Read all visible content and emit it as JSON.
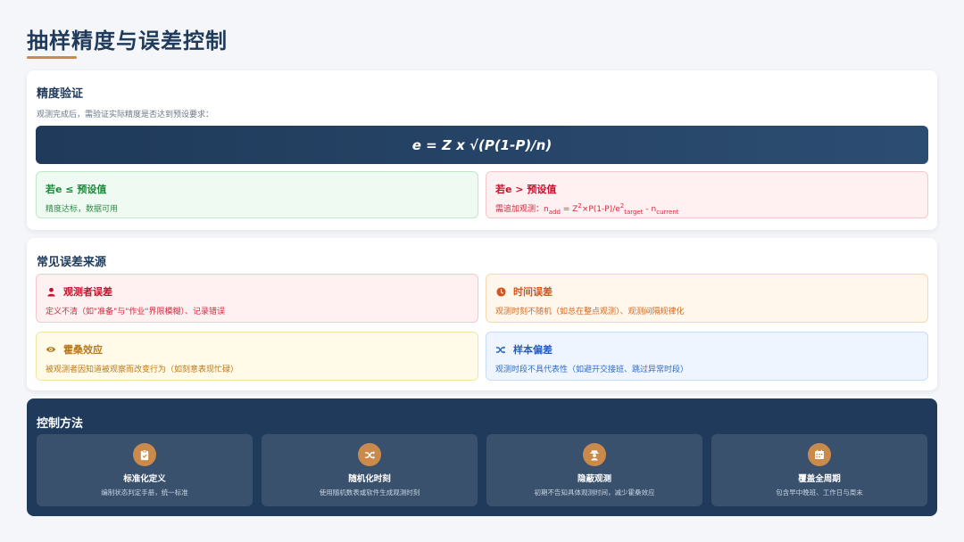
{
  "page": {
    "title": "抽样精度与误差控制"
  },
  "precision": {
    "heading": "精度验证",
    "description": "观测完成后，需验证实际精度是否达到预设要求：",
    "formula": "e = Z x √(P(1-P)/n)",
    "ok": {
      "title": "若e ≤ 预设值",
      "text": "精度达标，数据可用"
    },
    "fail": {
      "title": "若e > 预设值",
      "text_prefix": "需追加观测：",
      "n_letter": "n",
      "sub_add": "add",
      "eq_part": " = Z",
      "sup_2a": "2",
      "mid_part": "×P(1-P)/e",
      "sup_2b": "2",
      "sub_target": "target",
      "minus_part": " - n",
      "sub_current": "current"
    }
  },
  "errors": {
    "heading": "常见误差来源",
    "items": [
      {
        "title": "观测者误差",
        "text": "定义不清（如\"准备\"与\"作业\"界限模糊）、记录错误",
        "icon": "person-icon"
      },
      {
        "title": "时间误差",
        "text": "观测时刻不随机（如总在整点观测）、观测间隔规律化",
        "icon": "clock-icon"
      },
      {
        "title": "霍桑效应",
        "text": "被观测者因知道被观察而改变行为（如刻意表现忙碌）",
        "icon": "eye-icon"
      },
      {
        "title": "样本偏差",
        "text": "观测时段不具代表性（如避开交接班、跳过异常时段）",
        "icon": "shuffle-icon"
      }
    ]
  },
  "control": {
    "heading": "控制方法",
    "methods": [
      {
        "title": "标准化定义",
        "desc": "编制状态判定手册，统一标准",
        "icon": "clipboard-icon"
      },
      {
        "title": "随机化时刻",
        "desc": "使用随机数表或软件生成观测时刻",
        "icon": "shuffle-icon"
      },
      {
        "title": "隐蔽观测",
        "desc": "初期不告知具体观测时间，减少霍桑效应",
        "icon": "hidden-user-icon"
      },
      {
        "title": "覆盖全周期",
        "desc": "包含早中晚班、工作日与周末",
        "icon": "calendar-icon"
      }
    ]
  },
  "colors": {
    "navy": "#1f3a5a",
    "accent": "#c98a4b",
    "green": "#1a8a3a",
    "red": "#c8102e",
    "orange": "#d5531c",
    "yellow": "#b7791f",
    "blue": "#1f5fbf"
  }
}
